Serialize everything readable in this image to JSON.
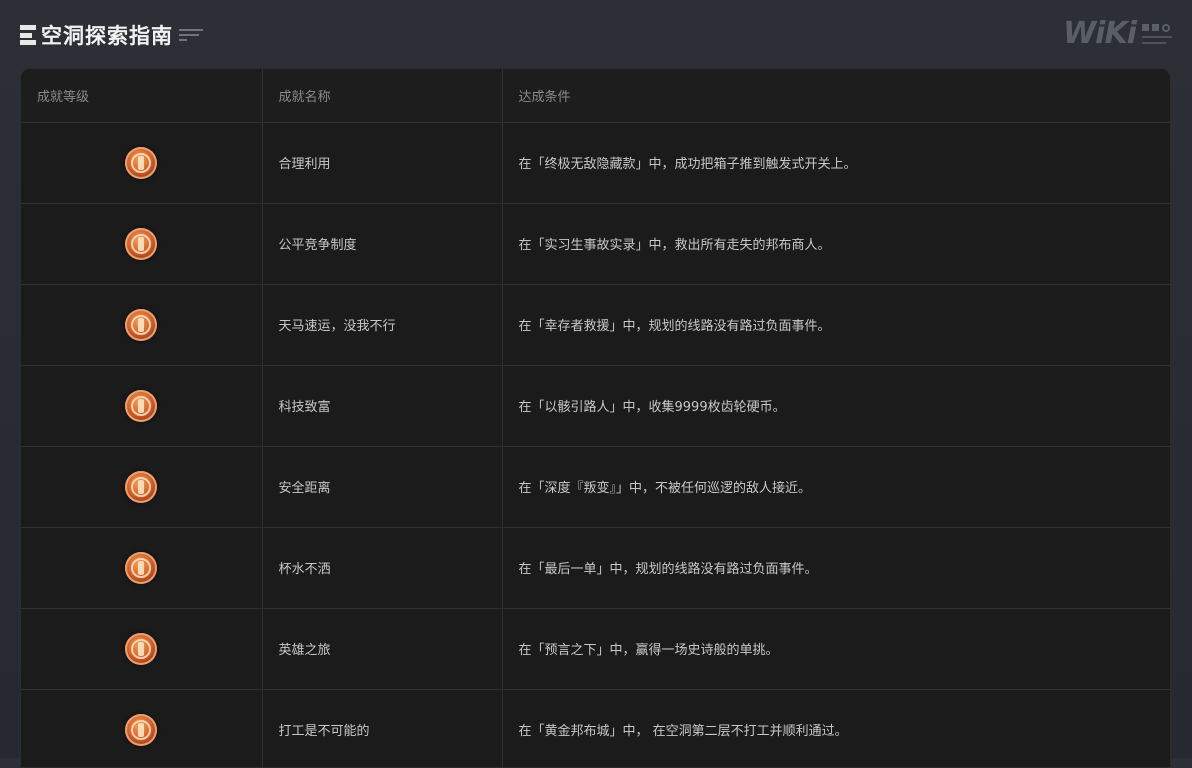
{
  "header": {
    "title": "空洞探索指南",
    "logo_text": "WiKi"
  },
  "table": {
    "columns": [
      "成就等级",
      "成就名称",
      "达成条件"
    ],
    "rows": [
      {
        "level_icon": "bronze-medal-icon",
        "name": "合理利用",
        "condition": "在「终极无敌隐藏款」中，成功把箱子推到触发式开关上。"
      },
      {
        "level_icon": "bronze-medal-icon",
        "name": "公平竞争制度",
        "condition": "在「实习生事故实录」中，救出所有走失的邦布商人。"
      },
      {
        "level_icon": "bronze-medal-icon",
        "name": "天马速运，没我不行",
        "condition": "在「幸存者救援」中，规划的线路没有路过负面事件。"
      },
      {
        "level_icon": "bronze-medal-icon",
        "name": "科技致富",
        "condition": "在「以骸引路人」中，收集9999枚齿轮硬币。"
      },
      {
        "level_icon": "bronze-medal-icon",
        "name": "安全距离",
        "condition": "在「深度『叛变』」中，不被任何巡逻的敌人接近。"
      },
      {
        "level_icon": "bronze-medal-icon",
        "name": "杯水不洒",
        "condition": "在「最后一单」中，规划的线路没有路过负面事件。"
      },
      {
        "level_icon": "bronze-medal-icon",
        "name": "英雄之旅",
        "condition": "在「预言之下」中，赢得一场史诗般的单挑。"
      },
      {
        "level_icon": "bronze-medal-icon",
        "name": "打工是不可能的",
        "condition": "在「黄金邦布城」中， 在空洞第二层不打工并顺利通过。"
      }
    ]
  }
}
